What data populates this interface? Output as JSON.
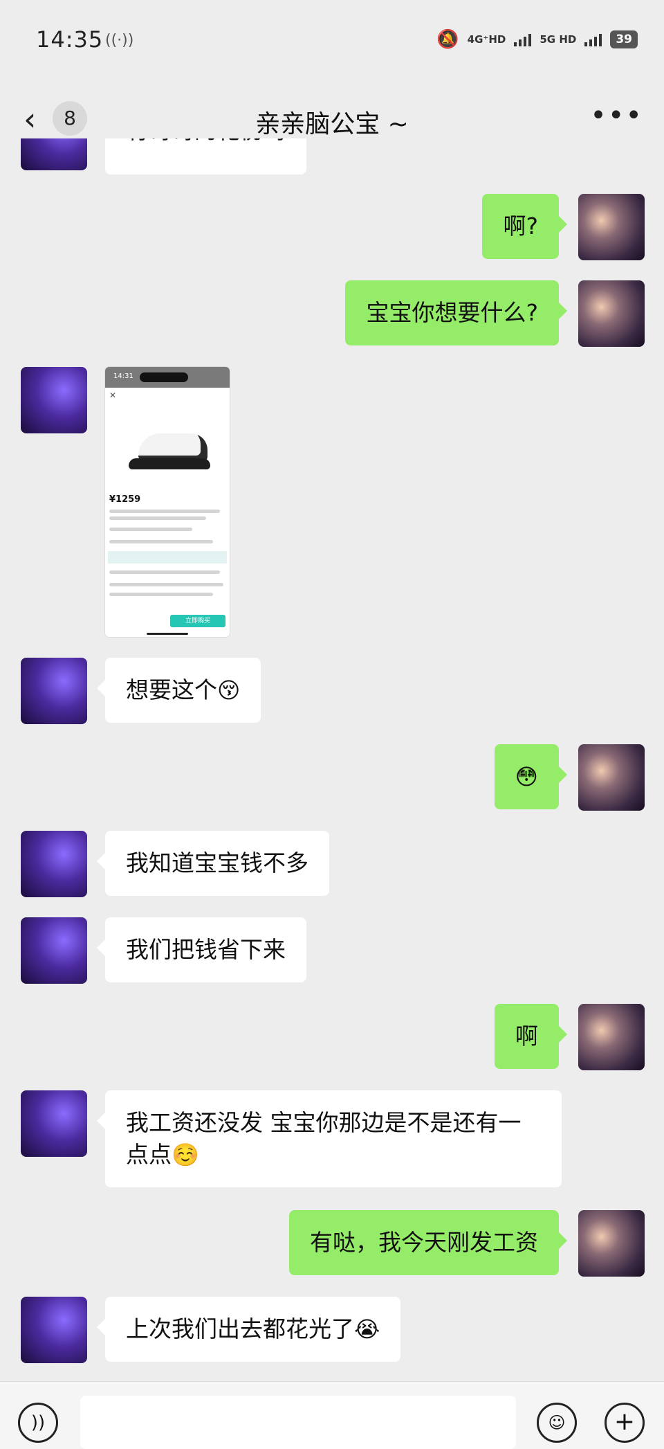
{
  "status_bar": {
    "time": "14:35",
    "net_4g": "4G⁺HD",
    "net_5g": "5G HD",
    "battery": "39"
  },
  "header": {
    "unread_count": "8",
    "title": "亲亲脑公宝 ~"
  },
  "messages": [
    {
      "from": "other",
      "text": "有哥哥的花伤吗"
    },
    {
      "from": "self",
      "text": "啊?"
    },
    {
      "from": "self",
      "text": "宝宝你想要什么?"
    },
    {
      "from": "other",
      "type": "image",
      "price": "¥1259"
    },
    {
      "from": "other",
      "text": "想要这个",
      "emoji": "😚"
    },
    {
      "from": "self",
      "emoji": "😳"
    },
    {
      "from": "other",
      "text": "我知道宝宝钱不多"
    },
    {
      "from": "other",
      "text": "我们把钱省下来"
    },
    {
      "from": "self",
      "text": "啊"
    },
    {
      "from": "other",
      "text": "我工资还没发 宝宝你那边是不是还有一点点",
      "emoji": "☺️"
    },
    {
      "from": "self",
      "text": "有哒，我今天刚发工资"
    },
    {
      "from": "other",
      "text": "上次我们出去都花光了",
      "emoji": "😭"
    }
  ],
  "image_card": {
    "clock": "14:31",
    "buy_label": "立即购买"
  },
  "colors": {
    "background": "#ededed",
    "bubble_in": "#ffffff",
    "bubble_out": "#95ec69"
  }
}
